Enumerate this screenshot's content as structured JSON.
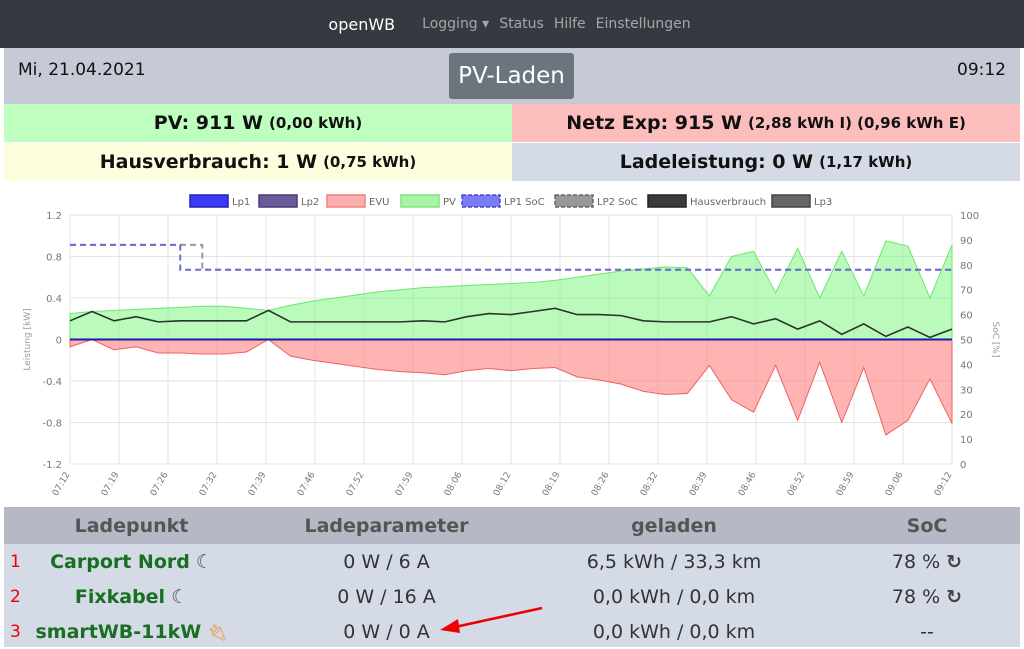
{
  "nav": {
    "brand": "openWB",
    "items": [
      "Logging ▾",
      "Status",
      "Hilfe",
      "Einstellungen"
    ]
  },
  "header": {
    "date": "Mi, 21.04.2021",
    "mode": "PV-Laden",
    "time": "09:12"
  },
  "tiles": {
    "pv": {
      "label": "PV: 911 W",
      "extra": "(0,00 kWh)",
      "color": "#befebe"
    },
    "netz": {
      "label": "Netz Exp: 915 W",
      "extra": "(2,88 kWh I) (0,96 kWh E)",
      "color": "#fcbebd"
    },
    "haus": {
      "label": "Hausverbrauch: 1 W",
      "extra": "(0,75 kWh)",
      "color": "#fefedf"
    },
    "lade": {
      "label": "Ladeleistung: 0 W",
      "extra": "(1,17 kWh)",
      "color": "#d5dae7"
    }
  },
  "chart_data": {
    "type": "area",
    "legend": [
      "Lp1",
      "Lp2",
      "EVU",
      "PV",
      "LP1 SoC",
      "LP2 SoC",
      "Hausverbrauch",
      "Lp3"
    ],
    "legend_placement": "top",
    "ylabel": "Leistung [kW]",
    "y2label": "SoC [%]",
    "ylim": [
      -1.2,
      1.2
    ],
    "y2lim": [
      0,
      100
    ],
    "yticks": [
      "1.2",
      "0.8",
      "0.4",
      "0",
      "-0.4",
      "-0.8",
      "-1.2"
    ],
    "y2ticks": [
      "100",
      "90",
      "80",
      "70",
      "60",
      "50",
      "40",
      "30",
      "20",
      "10",
      "0"
    ],
    "xticks": [
      "07:12",
      "07:19",
      "07:26",
      "07:32",
      "07:39",
      "07:46",
      "07:52",
      "07:59",
      "08:06",
      "08:12",
      "08:19",
      "08:26",
      "08:32",
      "08:39",
      "08:46",
      "08:52",
      "08:59",
      "09:06",
      "09:12"
    ],
    "x_minutes_step": 3,
    "pv": [
      0.25,
      0.27,
      0.28,
      0.29,
      0.3,
      0.31,
      0.32,
      0.32,
      0.3,
      0.28,
      0.33,
      0.37,
      0.4,
      0.43,
      0.46,
      0.48,
      0.5,
      0.51,
      0.52,
      0.53,
      0.54,
      0.55,
      0.57,
      0.6,
      0.63,
      0.66,
      0.68,
      0.7,
      0.69,
      0.42,
      0.8,
      0.85,
      0.45,
      0.88,
      0.4,
      0.85,
      0.42,
      0.95,
      0.9,
      0.4,
      0.91
    ],
    "hausverbrauch": [
      0.18,
      0.27,
      0.18,
      0.22,
      0.17,
      0.18,
      0.18,
      0.18,
      0.18,
      0.28,
      0.17,
      0.17,
      0.17,
      0.17,
      0.17,
      0.17,
      0.18,
      0.17,
      0.22,
      0.25,
      0.24,
      0.27,
      0.3,
      0.24,
      0.24,
      0.23,
      0.18,
      0.17,
      0.17,
      0.17,
      0.22,
      0.15,
      0.2,
      0.1,
      0.18,
      0.05,
      0.15,
      0.03,
      0.12,
      0.02,
      0.1
    ],
    "evu": [
      -0.07,
      0,
      -0.1,
      -0.07,
      -0.13,
      -0.13,
      -0.14,
      -0.14,
      -0.12,
      0,
      -0.16,
      -0.2,
      -0.23,
      -0.26,
      -0.29,
      -0.31,
      -0.32,
      -0.34,
      -0.3,
      -0.28,
      -0.3,
      -0.28,
      -0.27,
      -0.36,
      -0.39,
      -0.43,
      -0.5,
      -0.53,
      -0.52,
      -0.25,
      -0.58,
      -0.7,
      -0.25,
      -0.78,
      -0.22,
      -0.8,
      -0.27,
      -0.92,
      -0.78,
      -0.38,
      -0.81
    ],
    "lp1": 0,
    "lp1_soc": [
      {
        "from": "07:12",
        "to": "07:27",
        "value": 88
      },
      {
        "from": "07:27",
        "to": "09:12",
        "value": 78
      }
    ],
    "lp2_soc": [
      {
        "from": "07:12",
        "to": "07:30",
        "value": 88
      },
      {
        "from": "07:30",
        "to": "09:12",
        "value": 78
      }
    ]
  },
  "table": {
    "headers": [
      "Ladepunkt",
      "Ladeparameter",
      "geladen",
      "SoC"
    ],
    "rows": [
      {
        "num": "1",
        "name": "Carport Nord",
        "icon": "moon",
        "param": "0 W / 6 A",
        "geladen": "6,5 kWh / 33,3 km",
        "soc": "78 %"
      },
      {
        "num": "2",
        "name": "Fixkabel",
        "icon": "moon",
        "param": "0 W / 16 A",
        "geladen": "0,0 kWh / 0,0 km",
        "soc": "78 %"
      },
      {
        "num": "3",
        "name": "smartWB-11kW",
        "icon": "plug",
        "param": "0 W / 0 A",
        "geladen": "0,0 kWh / 0,0 km",
        "soc": "--"
      }
    ]
  }
}
